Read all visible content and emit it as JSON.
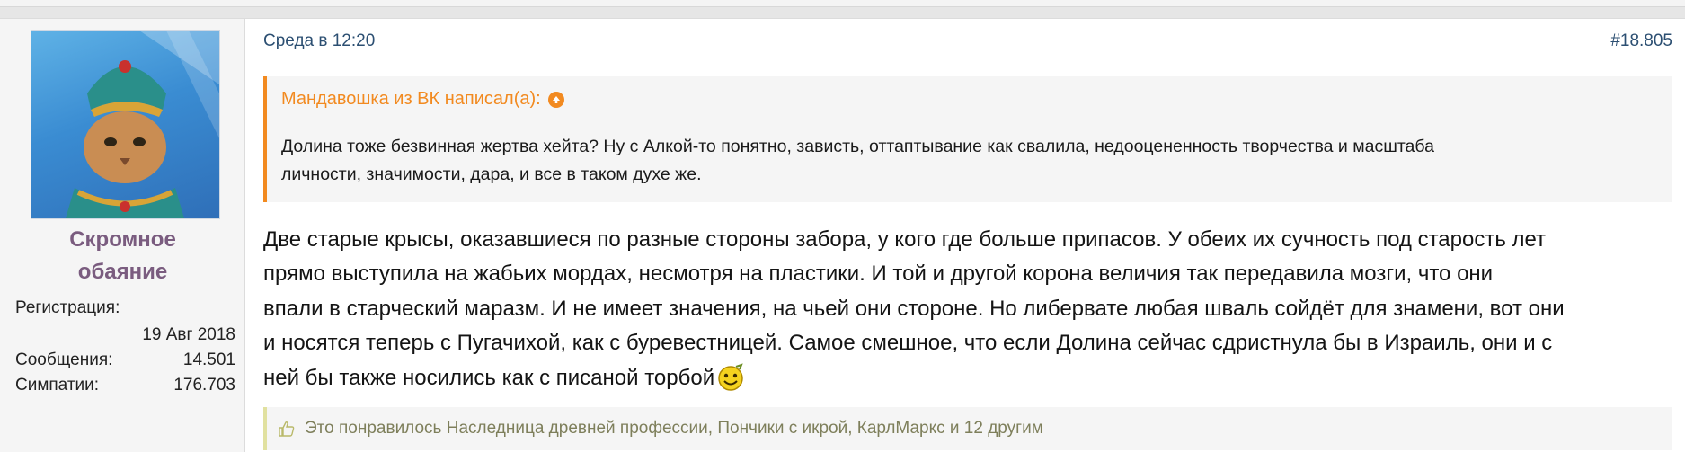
{
  "user": {
    "name_line1": "Скромное",
    "name_line2": "обаяние",
    "registration_label": "Регистрация:",
    "registration_value": "19 Авг 2018",
    "messages_label": "Сообщения:",
    "messages_value": "14.501",
    "likes_label": "Симпатии:",
    "likes_value": "176.703"
  },
  "post": {
    "date": "Среда в 12:20",
    "number": "#18.805",
    "quote": {
      "author_line": "Мандавошка из ВК написал(а):",
      "line1": "Долина тоже безвинная жертва хейта? Ну с Алкой-то понятно, зависть, оттаптывание как свалила, недооцененность творчества и масштаба",
      "line2": "личности, значимости, дара, и все в таком духе же."
    },
    "body_lines": [
      "Две старые крысы, оказавшиеся по разные стороны забора, у кого где больше припасов. У обеих их сучность под старость лет",
      "прямо выступила на жабьих мордах, несмотря на пластики. И той и другой корона величия так передавила мозги, что они",
      "впали в старческий маразм. И не имеет значения, на чьей они стороне. Но либервате любая шваль сойдёт для знамени, вот они",
      "и носятся теперь с Пугачихой, как с буревестницей. Самое смешное, что если Долина сейчас сдристнула бы в Израиль, они и с",
      "ней бы также носились как с писаной торбой"
    ],
    "likes_text": "Это понравилось Наследница древней профессии, Пончики с икрой, КарлМаркс и 12 другим"
  },
  "colors": {
    "quote_accent": "#f28a20",
    "username": "#7a5c7f",
    "link": "#2c4f72",
    "likes_text": "#7e7f5b"
  },
  "icons": [
    "arrow-up-circle-icon",
    "thumbs-up-icon",
    "smiley-icon"
  ]
}
